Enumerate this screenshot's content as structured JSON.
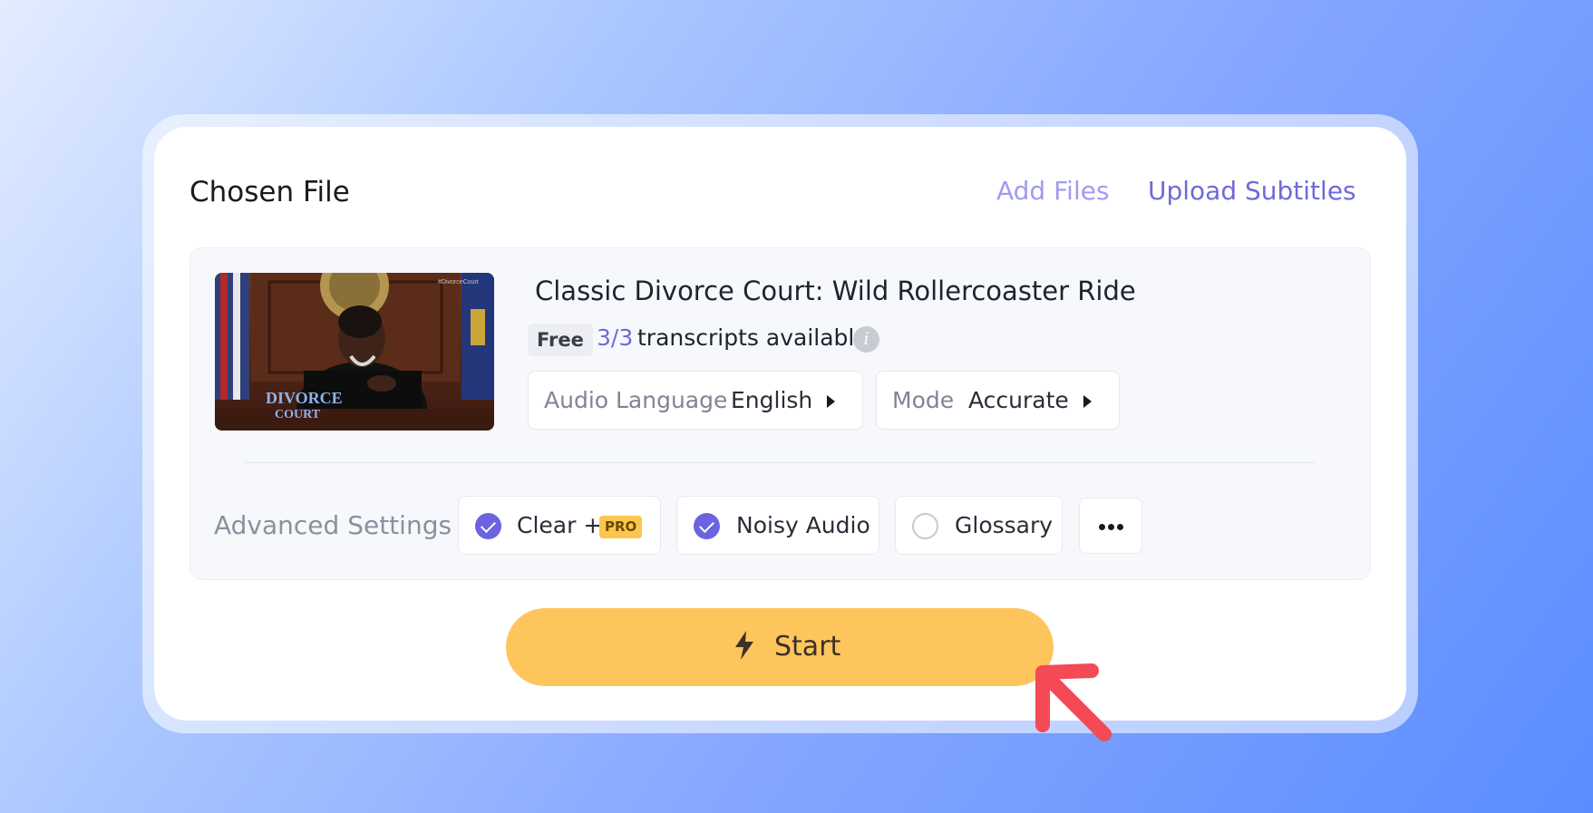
{
  "header": {
    "title": "Chosen File",
    "add_files": "Add Files",
    "upload_subtitles": "Upload Subtitles"
  },
  "file": {
    "name": "Classic Divorce Court: Wild Rollercoaster Ride",
    "plan_badge": "Free",
    "transcripts_count": "3/3",
    "transcripts_label": "transcripts available",
    "info_icon": "i",
    "thumbnail": {
      "icon": "video-thumbnail",
      "logo_text": "DIVORCE COURT",
      "watermark": "#DivorceCourt"
    }
  },
  "audio_language": {
    "label": "Audio Language",
    "value": "English"
  },
  "mode": {
    "label": "Mode",
    "value": "Accurate"
  },
  "advanced": {
    "label": "Advanced Settings",
    "options": [
      {
        "label": "Clear +",
        "checked": true,
        "badge": "PRO"
      },
      {
        "label": "Noisy Audio",
        "checked": true
      },
      {
        "label": "Glossary",
        "checked": false
      }
    ],
    "more_icon": "ellipsis-icon"
  },
  "start_button": {
    "label": "Start",
    "icon": "bolt-icon"
  },
  "colors": {
    "accent": "#6c63e0",
    "start_bg": "#fec55d",
    "pro_badge": "#fcc54e",
    "pointer_arrow": "#f44a55"
  }
}
